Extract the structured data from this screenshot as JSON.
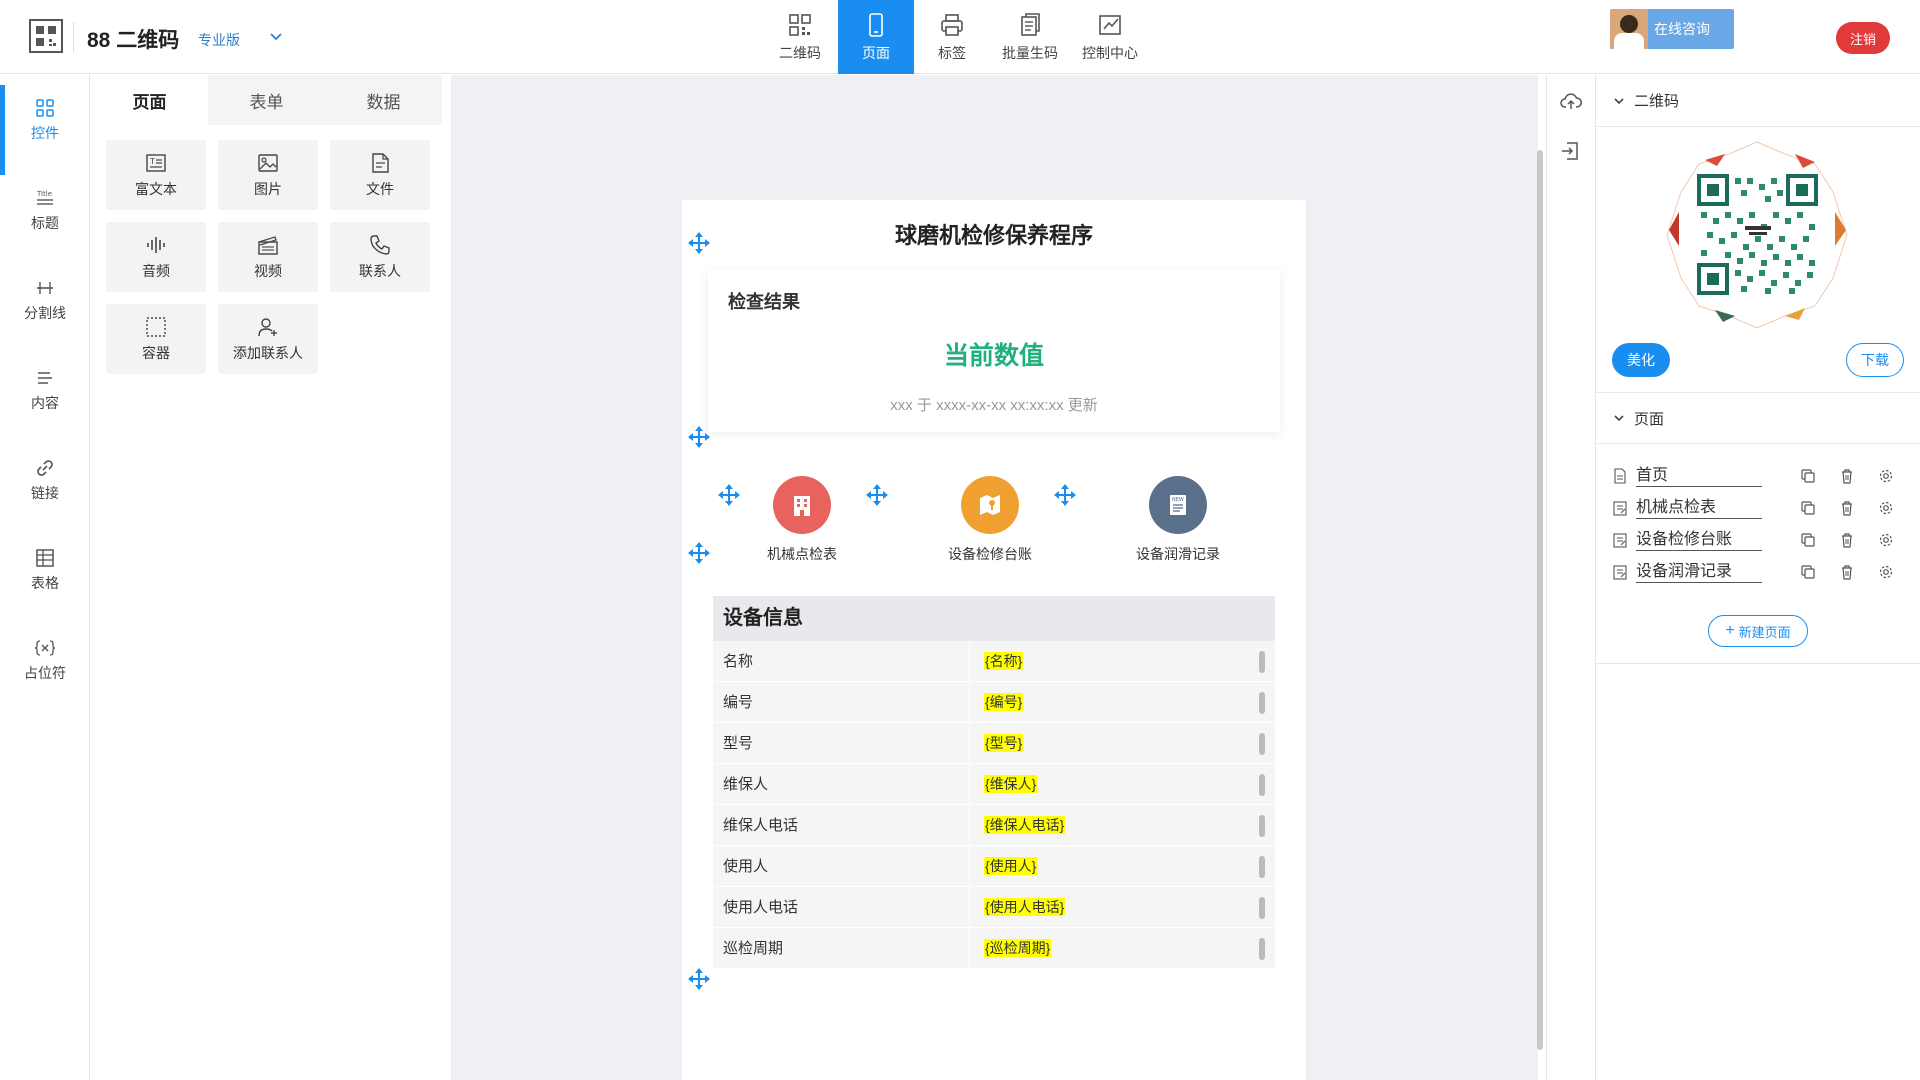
{
  "app": {
    "title": "88 二维码",
    "edition": "专业版",
    "consult": "在线咨询",
    "logout": "注销"
  },
  "topnav": [
    {
      "label": "二维码",
      "icon": "qrcode-icon"
    },
    {
      "label": "页面",
      "icon": "mobile-icon",
      "active": true
    },
    {
      "label": "标签",
      "icon": "printer-icon"
    },
    {
      "label": "批量生码",
      "icon": "batch-icon"
    },
    {
      "label": "控制中心",
      "icon": "control-icon"
    }
  ],
  "rail": [
    {
      "label": "控件",
      "icon": "grid-icon",
      "active": true
    },
    {
      "label": "标题",
      "icon": "title-icon"
    },
    {
      "label": "分割线",
      "icon": "divider-icon"
    },
    {
      "label": "内容",
      "icon": "content-icon"
    },
    {
      "label": "链接",
      "icon": "link-icon"
    },
    {
      "label": "表格",
      "icon": "table-icon"
    },
    {
      "label": "占位符",
      "icon": "placeholder-icon"
    }
  ],
  "panel": {
    "tabs": [
      "页面",
      "表单",
      "数据"
    ],
    "components": [
      {
        "label": "富文本",
        "icon": "richtext-icon"
      },
      {
        "label": "图片",
        "icon": "image-icon"
      },
      {
        "label": "文件",
        "icon": "file-icon"
      },
      {
        "label": "音频",
        "icon": "audio-icon"
      },
      {
        "label": "视频",
        "icon": "video-icon"
      },
      {
        "label": "联系人",
        "icon": "phone-icon"
      },
      {
        "label": "容器",
        "icon": "container-icon"
      },
      {
        "label": "添加联系人",
        "icon": "add-contact-icon"
      }
    ]
  },
  "page": {
    "title": "球磨机检修保养程序",
    "card": {
      "label": "检查结果",
      "value": "当前数值",
      "sub": "xxx 于 xxxx-xx-xx xx:xx:xx 更新"
    },
    "quick": [
      {
        "label": "机械点检表",
        "color": "#e8625e",
        "icon": "building-icon"
      },
      {
        "label": "设备检修台账",
        "color": "#f0a030",
        "icon": "map-icon"
      },
      {
        "label": "设备润滑记录",
        "color": "#5a6f8a",
        "icon": "new-doc-icon"
      }
    ],
    "info": {
      "title": "设备信息",
      "rows": [
        {
          "key": "名称",
          "value": "{名称}"
        },
        {
          "key": "编号",
          "value": "{编号}"
        },
        {
          "key": "型号",
          "value": "{型号}"
        },
        {
          "key": "维保人",
          "value": "{维保人}"
        },
        {
          "key": "维保人电话",
          "value": "{维保人电话}"
        },
        {
          "key": "使用人",
          "value": "{使用人}"
        },
        {
          "key": "使用人电话",
          "value": "{使用人电话}"
        },
        {
          "key": "巡检周期",
          "value": "{巡检周期}"
        }
      ]
    }
  },
  "rpanel": {
    "qr_section": "二维码",
    "beautify": "美化",
    "download": "下载",
    "pages_section": "页面",
    "pages": [
      "首页",
      "机械点检表",
      "设备检修台账",
      "设备润滑记录"
    ],
    "new_page": "新建页面"
  },
  "colors": {
    "accent": "#1a8ef0",
    "value_green": "#22b07d",
    "logout_red": "#e03a3a"
  }
}
